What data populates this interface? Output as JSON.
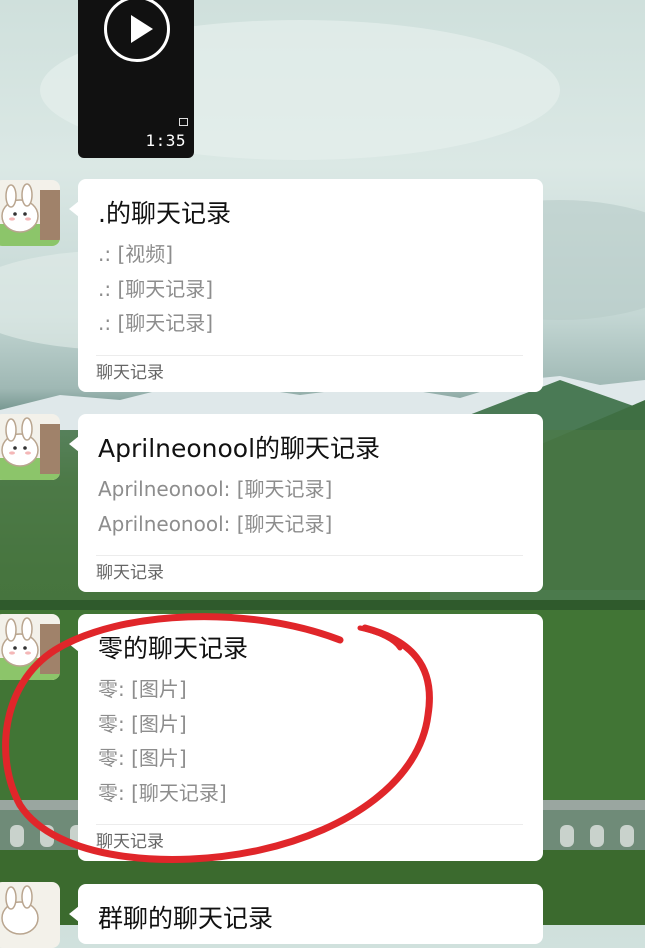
{
  "video": {
    "duration": "1:35"
  },
  "chats": [
    {
      "title": ".的聊天记录",
      "lines": [
        ".: [视频]",
        ".: [聊天记录]",
        ".: [聊天记录]"
      ],
      "footer": "聊天记录"
    },
    {
      "title": "Aprilneonool的聊天记录",
      "lines": [
        "Aprilneonool: [聊天记录]",
        "Aprilneonool: [聊天记录]"
      ],
      "footer": "聊天记录"
    },
    {
      "title": "零的聊天记录",
      "lines": [
        "零: [图片]",
        "零: [图片]",
        "零: [图片]",
        "零: [聊天记录]"
      ],
      "footer": "聊天记录"
    },
    {
      "title": "群聊的聊天记录"
    }
  ],
  "colors": {
    "annotation_circle": "#e0262a",
    "card_bg": "#ffffff",
    "title_text": "#111111",
    "preview_text": "#8d8d8d"
  },
  "icons": [
    "play-icon",
    "avatar-bunny-icon"
  ]
}
